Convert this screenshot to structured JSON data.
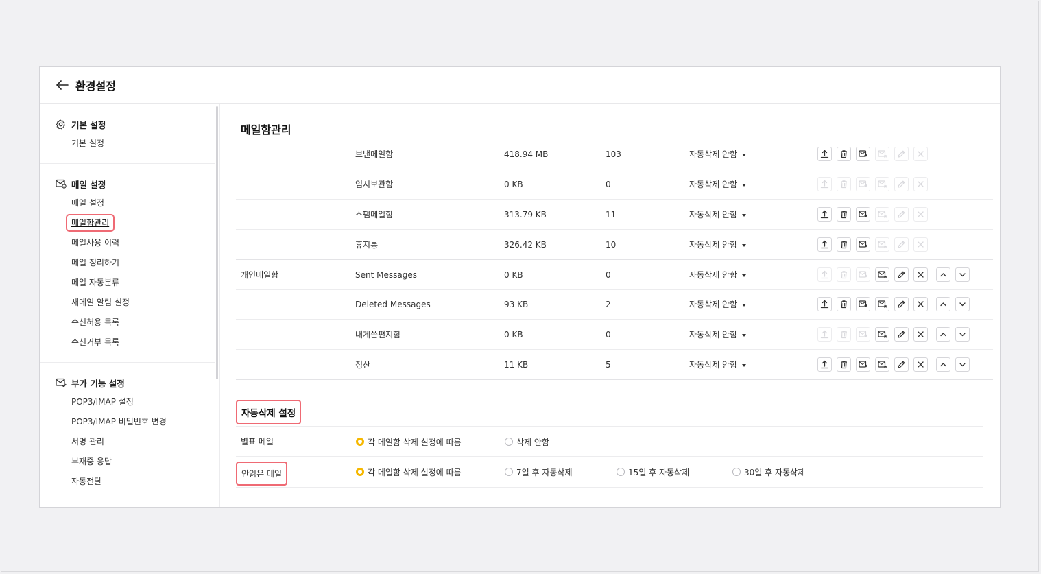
{
  "header": {
    "title": "환경설정"
  },
  "sidebar": {
    "sections": [
      {
        "title": "기본 설정",
        "icon": "gear-icon",
        "items": [
          "기본 설정"
        ]
      },
      {
        "title": "메일 설정",
        "icon": "mail-settings-icon",
        "items": [
          "메일 설정",
          "메일함관리",
          "메일사용 이력",
          "메일 정리하기",
          "메일 자동분류",
          "새메일 알림 설정",
          "수신허용 목록",
          "수신거부 목록"
        ]
      },
      {
        "title": "부가 기능 설정",
        "icon": "mail-extra-icon",
        "items": [
          "POP3/IMAP 설정",
          "POP3/IMAP 비밀번호 변경",
          "서명 관리",
          "부재중 응답",
          "자동전달"
        ]
      }
    ],
    "active_item": "메일함관리"
  },
  "main": {
    "title": "메일함관리",
    "personal_group_label": "개인메일함",
    "auto_option": "자동삭제 안함",
    "mailboxes": [
      {
        "name": "보낸메일함",
        "size": "418.94 MB",
        "count": "103",
        "group": "system"
      },
      {
        "name": "임시보관함",
        "size": "0 KB",
        "count": "0",
        "group": "system"
      },
      {
        "name": "스팸메일함",
        "size": "313.79 KB",
        "count": "11",
        "group": "system"
      },
      {
        "name": "휴지통",
        "size": "326.42 KB",
        "count": "10",
        "group": "system"
      },
      {
        "name": "Sent Messages",
        "size": "0 KB",
        "count": "0",
        "group": "personal"
      },
      {
        "name": "Deleted Messages",
        "size": "93 KB",
        "count": "2",
        "group": "personal"
      },
      {
        "name": "내게쓴편지함",
        "size": "0 KB",
        "count": "0",
        "group": "personal"
      },
      {
        "name": "정산",
        "size": "11 KB",
        "count": "5",
        "group": "personal"
      }
    ]
  },
  "auto_delete": {
    "title": "자동삭제 설정",
    "starred": {
      "label": "별표 메일",
      "options": [
        "각 메일함 삭제 설정에 따름",
        "삭제 안함"
      ],
      "selected": 0
    },
    "unread": {
      "label": "안읽은 메일",
      "options": [
        "각 메일함 삭제 설정에 따름",
        "7일 후 자동삭제",
        "15일 후 자동삭제",
        "30일 후 자동삭제"
      ],
      "selected": 0
    }
  },
  "colors": {
    "highlight": "#ef6a74",
    "radio_on": "#f6b800"
  }
}
